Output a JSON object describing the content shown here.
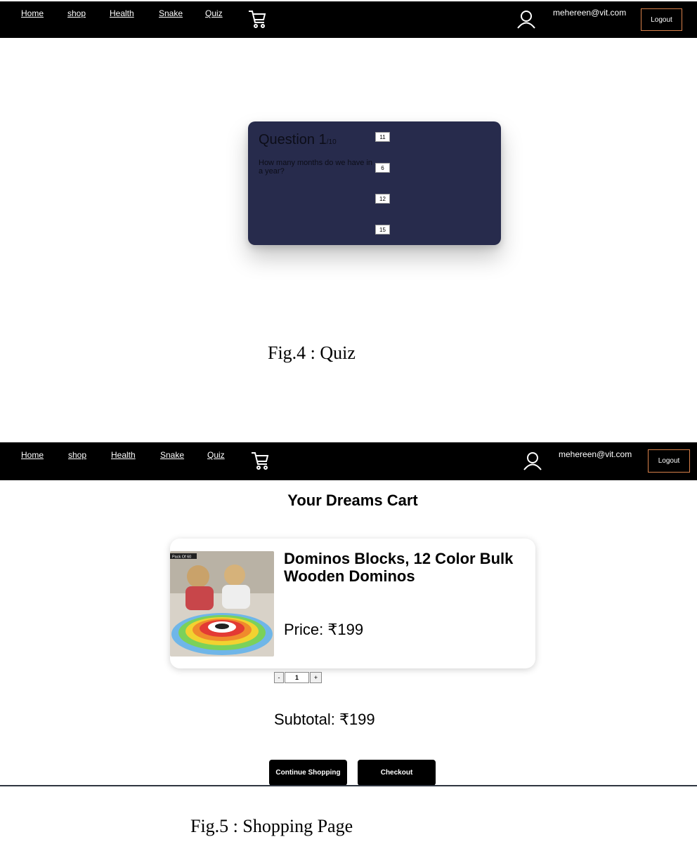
{
  "screens": [
    {
      "nav": {
        "links": [
          "Home",
          "shop",
          "Health",
          "Snake",
          "Quiz"
        ],
        "email": "mehereen@vit.com",
        "logout": "Logout"
      }
    },
    {
      "nav": {
        "links": [
          "Home",
          "shop",
          "Health",
          "Snake",
          "Quiz"
        ],
        "email": "mehereen@vit.com",
        "logout": "Logout"
      }
    }
  ],
  "quiz": {
    "question_label": "Question 1",
    "question_total": "/10",
    "question_text": "How many months do we have in a year?",
    "answers": [
      "11",
      "6",
      "12",
      "15"
    ]
  },
  "captions": {
    "fig4": "Fig.4 : Quiz",
    "fig5": "Fig.5 : Shopping Page"
  },
  "cart": {
    "title": "Your Dreams Cart",
    "product": {
      "badge": "Pack Of 60",
      "name": "Dominos Blocks, 12 Color Bulk Wooden Dominos",
      "price": "Price: ₹199"
    },
    "quantity": {
      "minus": "-",
      "value": "1",
      "plus": "+"
    },
    "subtotal": "Subtotal: ₹199",
    "continue_label": "Continue Shopping",
    "checkout_label": "Checkout"
  }
}
